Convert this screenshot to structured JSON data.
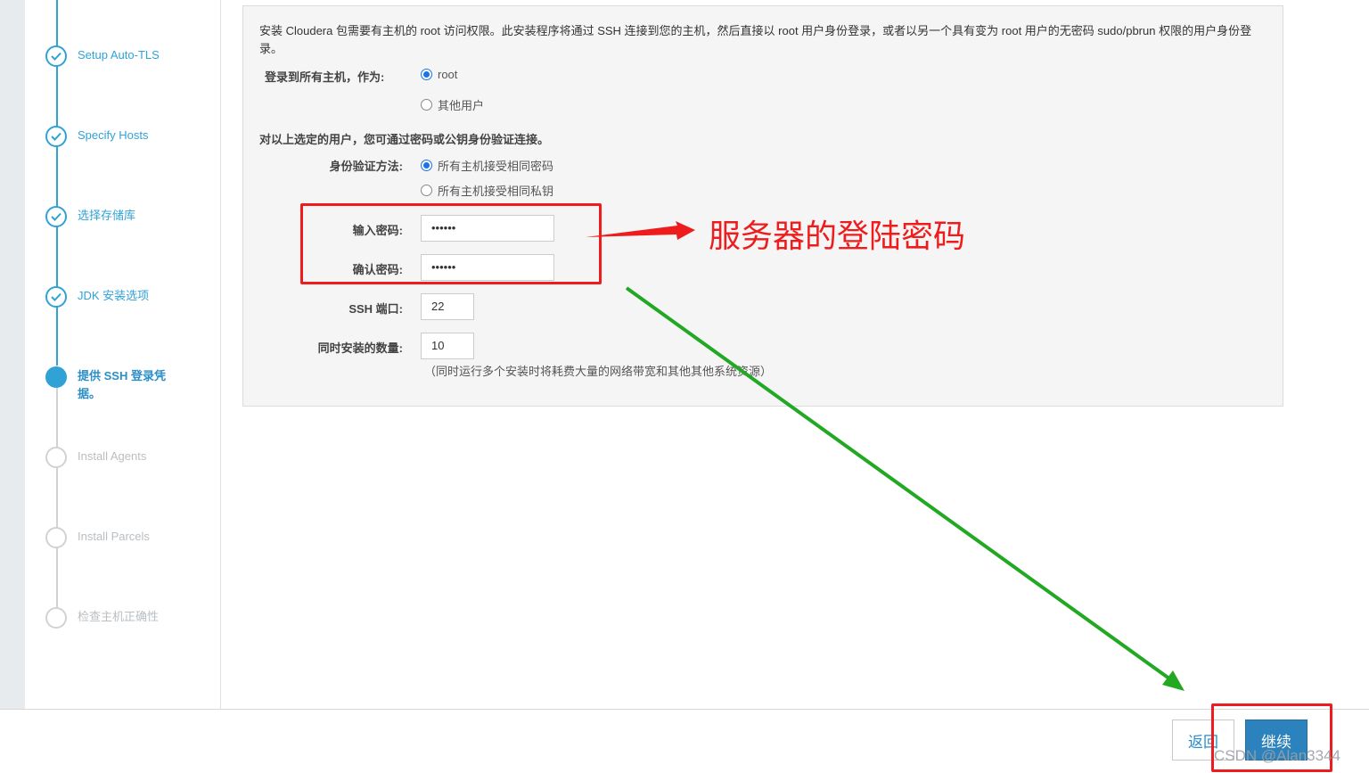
{
  "sidebar": {
    "steps": [
      {
        "label": "Setup Auto-TLS",
        "status": "done"
      },
      {
        "label": "Specify Hosts",
        "status": "done"
      },
      {
        "label": "选择存储库",
        "status": "done"
      },
      {
        "label": "JDK 安装选项",
        "status": "done"
      },
      {
        "label": "提供 SSH 登录凭据。",
        "status": "current"
      },
      {
        "label": "Install Agents",
        "status": "todo"
      },
      {
        "label": "Install Parcels",
        "status": "todo"
      },
      {
        "label": "检查主机正确性",
        "status": "todo"
      }
    ]
  },
  "form": {
    "intro": "安装 Cloudera 包需要有主机的 root 访问权限。此安装程序将通过 SSH 连接到您的主机，然后直接以 root 用户身份登录，或者以另一个具有变为 root 用户的无密码 sudo/pbrun 权限的用户身份登录。",
    "login_label": "登录到所有主机，作为:",
    "login_options": [
      {
        "label": "root",
        "selected": true
      },
      {
        "label": "其他用户",
        "selected": false
      }
    ],
    "auth_intro": "对以上选定的用户，您可通过密码或公钥身份验证连接。",
    "auth_label": "身份验证方法:",
    "auth_options": [
      {
        "label": "所有主机接受相同密码",
        "selected": true
      },
      {
        "label": "所有主机接受相同私钥",
        "selected": false
      }
    ],
    "password_label": "输入密码:",
    "password_value": "••••••",
    "confirm_label": "确认密码:",
    "confirm_value": "••••••",
    "ssh_port_label": "SSH 端口:",
    "ssh_port_value": "22",
    "concurrent_label": "同时安装的数量:",
    "concurrent_value": "10",
    "concurrent_note": "（同时运行多个安装时将耗费大量的网络带宽和其他其他系统资源）"
  },
  "footer": {
    "back_label": "返回",
    "next_label": "继续"
  },
  "annotation": {
    "text": "服务器的登陆密码",
    "color": "#ee1c1c",
    "arrow_color": "#22a822"
  },
  "watermark": "CSDN @Alan3344",
  "colors": {
    "accent": "#30a2d6",
    "primary_button": "#2b82bd"
  }
}
